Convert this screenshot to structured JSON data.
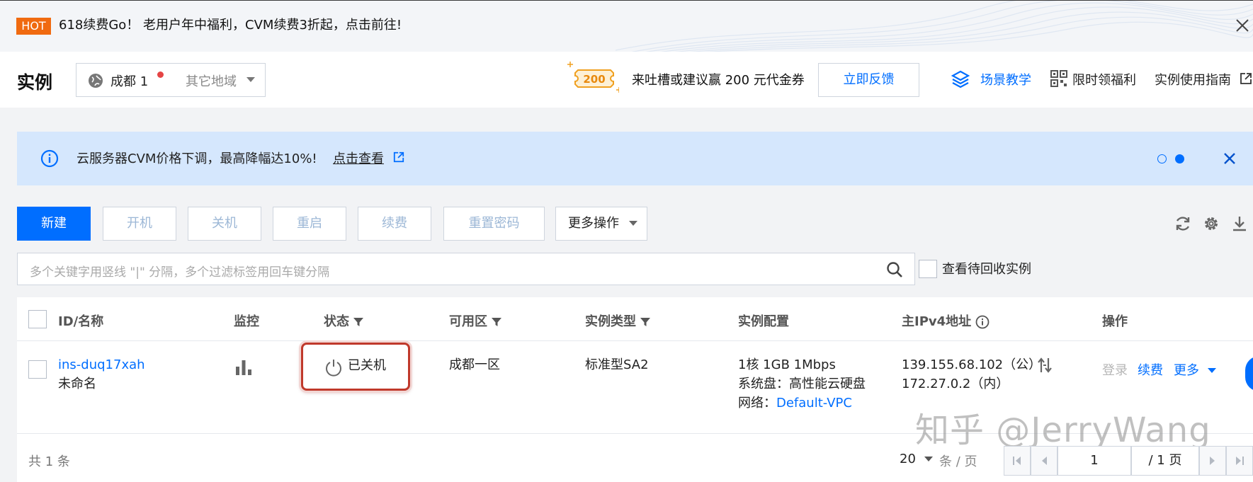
{
  "promo": {
    "badge": "HOT",
    "text": "618续费Go！ 老用户年中福利，CVM续费3折起，点击前往!"
  },
  "header": {
    "title": "实例",
    "region": {
      "current": "成都 1",
      "other": "其它地域"
    },
    "coupon_amount": "200",
    "feedback_text": "来吐槽或建议赢 200 元代金券",
    "feedback_button": "立即反馈",
    "links": [
      "场景教学",
      "限时领福利",
      "实例使用指南"
    ]
  },
  "notice": {
    "text": "云服务器CVM价格下调，最高降幅达10%!",
    "link": "点击查看"
  },
  "toolbar": {
    "buttons": [
      "新建",
      "开机",
      "关机",
      "重启",
      "续费",
      "重置密码"
    ],
    "more": "更多操作"
  },
  "search": {
    "placeholder": "多个关键字用竖线 \"|\" 分隔，多个过滤标签用回车键分隔",
    "recycle_label": "查看待回收实例"
  },
  "table": {
    "headers": {
      "id": "ID/名称",
      "monitor": "监控",
      "status": "状态",
      "zone": "可用区",
      "type": "实例类型",
      "config": "实例配置",
      "ip": "主IPv4地址",
      "ops": "操作"
    },
    "rows": [
      {
        "id": "ins-duq17xah",
        "name": "未命名",
        "status": "已关机",
        "zone": "成都一区",
        "type": "标准型SA2",
        "config_line1": "1核 1GB 1Mbps",
        "config_line2": "系统盘：高性能云硬盘",
        "network_label": "网络：",
        "network_value": "Default-VPC",
        "ip_public": "139.155.68.102（公）",
        "ip_private": "172.27.0.2（内）",
        "op_login": "登录",
        "op_renew": "续费",
        "op_more": "更多"
      }
    ]
  },
  "watermark": "知乎 @JerryWang",
  "footer": {
    "total": "共 1 条",
    "page_size": "20",
    "per_page": "条 / 页",
    "page": "1",
    "page_total": "/ 1 页"
  },
  "colors": {
    "accent": "#006eff",
    "hot": "#f06a10",
    "notice_bg": "#d5e7fd",
    "status_highlight": "#c0392b"
  }
}
